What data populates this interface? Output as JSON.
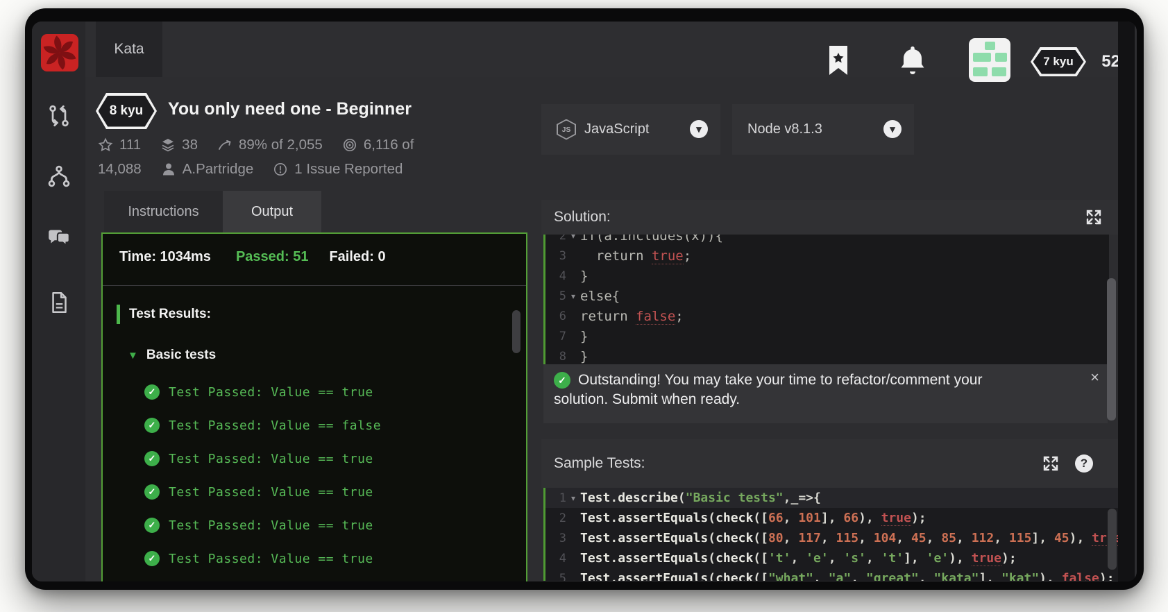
{
  "icons": {
    "chevron_down": "▾",
    "fold": "▾",
    "group_arrow": "▼",
    "check": "✓",
    "close": "×",
    "help": "?",
    "js_label": "JS"
  },
  "header": {
    "tab": "Kata",
    "rank": "7 kyu",
    "honor": "52"
  },
  "kata": {
    "rank": "8 kyu",
    "title": "You only need one - Beginner",
    "stats_row1": [
      {
        "icon": "star-icon",
        "text": "111"
      },
      {
        "icon": "layers-icon",
        "text": "38"
      },
      {
        "icon": "completion-icon",
        "text": "89% of 2,055"
      },
      {
        "icon": "target-icon",
        "text": "6,116 of"
      }
    ],
    "stats_row2": [
      {
        "icon": null,
        "text": "14,088"
      },
      {
        "icon": "person-icon",
        "text": "A.Partridge"
      },
      {
        "icon": "issue-icon",
        "text": "1 Issue Reported"
      }
    ]
  },
  "tabs": {
    "instructions": "Instructions",
    "output": "Output"
  },
  "output": {
    "time": "Time: 1034ms",
    "passed": "Passed: 51",
    "failed": "Failed: 0",
    "section": "Test Results:",
    "group": "Basic tests",
    "tests": [
      "Test Passed: Value == true",
      "Test Passed: Value == false",
      "Test Passed: Value == true",
      "Test Passed: Value == true",
      "Test Passed: Value == true",
      "Test Passed: Value == true"
    ]
  },
  "language": {
    "name": "JavaScript",
    "runtime": "Node v8.1.3"
  },
  "solution": {
    "title": "Solution:",
    "lines": [
      {
        "n": "2",
        "fold": true,
        "tokens": [
          [
            "plain",
            "if(a.includes(x)){"
          ]
        ]
      },
      {
        "n": "3",
        "tokens": [
          [
            "plain",
            "  return "
          ],
          [
            "bool",
            "true"
          ],
          [
            "plain",
            ";"
          ]
        ]
      },
      {
        "n": "4",
        "tokens": [
          [
            "plain",
            "}"
          ]
        ]
      },
      {
        "n": "5",
        "fold": true,
        "tokens": [
          [
            "plain",
            "else{"
          ]
        ]
      },
      {
        "n": "6",
        "tokens": [
          [
            "plain",
            "return "
          ],
          [
            "bool",
            "false"
          ],
          [
            "plain",
            ";"
          ]
        ]
      },
      {
        "n": "7",
        "tokens": [
          [
            "plain",
            "}"
          ]
        ]
      },
      {
        "n": "8",
        "tokens": [
          [
            "plain",
            "}"
          ]
        ]
      }
    ]
  },
  "message": {
    "line1": "Outstanding! You may take your time to refactor/comment your",
    "line2": "solution. Submit when ready."
  },
  "sample": {
    "title": "Sample Tests:",
    "lines": [
      {
        "n": "1",
        "fold": true,
        "highlight": true,
        "tokens": [
          [
            "ident",
            "Test"
          ],
          [
            "plain",
            "."
          ],
          [
            "ident",
            "describe"
          ],
          [
            "plain",
            "("
          ],
          [
            "str",
            "\"Basic tests\""
          ],
          [
            "plain",
            ",_=>{"
          ]
        ]
      },
      {
        "n": "2",
        "tokens": [
          [
            "ident",
            "Test"
          ],
          [
            "plain",
            "."
          ],
          [
            "ident",
            "assertEquals"
          ],
          [
            "plain",
            "("
          ],
          [
            "ident",
            "check"
          ],
          [
            "plain",
            "(["
          ],
          [
            "num",
            "66"
          ],
          [
            "plain",
            ", "
          ],
          [
            "num",
            "101"
          ],
          [
            "plain",
            "], "
          ],
          [
            "num",
            "66"
          ],
          [
            "plain",
            "), "
          ],
          [
            "bool",
            "true"
          ],
          [
            "plain",
            ");"
          ]
        ]
      },
      {
        "n": "3",
        "tokens": [
          [
            "ident",
            "Test"
          ],
          [
            "plain",
            "."
          ],
          [
            "ident",
            "assertEquals"
          ],
          [
            "plain",
            "("
          ],
          [
            "ident",
            "check"
          ],
          [
            "plain",
            "(["
          ],
          [
            "num",
            "80"
          ],
          [
            "plain",
            ", "
          ],
          [
            "num",
            "117"
          ],
          [
            "plain",
            ", "
          ],
          [
            "num",
            "115"
          ],
          [
            "plain",
            ", "
          ],
          [
            "num",
            "104"
          ],
          [
            "plain",
            ", "
          ],
          [
            "num",
            "45"
          ],
          [
            "plain",
            ", "
          ],
          [
            "num",
            "85"
          ],
          [
            "plain",
            ", "
          ],
          [
            "num",
            "112"
          ],
          [
            "plain",
            ", "
          ],
          [
            "num",
            "115"
          ],
          [
            "plain",
            "], "
          ],
          [
            "num",
            "45"
          ],
          [
            "plain",
            "), "
          ],
          [
            "bool",
            "true"
          ],
          [
            "plain",
            ");"
          ]
        ]
      },
      {
        "n": "4",
        "tokens": [
          [
            "ident",
            "Test"
          ],
          [
            "plain",
            "."
          ],
          [
            "ident",
            "assertEquals"
          ],
          [
            "plain",
            "("
          ],
          [
            "ident",
            "check"
          ],
          [
            "plain",
            "(["
          ],
          [
            "str",
            "'t'"
          ],
          [
            "plain",
            ", "
          ],
          [
            "str",
            "'e'"
          ],
          [
            "plain",
            ", "
          ],
          [
            "str",
            "'s'"
          ],
          [
            "plain",
            ", "
          ],
          [
            "str",
            "'t'"
          ],
          [
            "plain",
            "], "
          ],
          [
            "str",
            "'e'"
          ],
          [
            "plain",
            "), "
          ],
          [
            "bool",
            "true"
          ],
          [
            "plain",
            ");"
          ]
        ]
      },
      {
        "n": "5",
        "tokens": [
          [
            "ident",
            "Test"
          ],
          [
            "plain",
            "."
          ],
          [
            "ident",
            "assertEquals"
          ],
          [
            "plain",
            "("
          ],
          [
            "ident",
            "check"
          ],
          [
            "plain",
            "(["
          ],
          [
            "str",
            "\"what\""
          ],
          [
            "plain",
            ", "
          ],
          [
            "str",
            "\"a\""
          ],
          [
            "plain",
            ", "
          ],
          [
            "str",
            "\"great\""
          ],
          [
            "plain",
            ", "
          ],
          [
            "str",
            "\"kata\""
          ],
          [
            "plain",
            "], "
          ],
          [
            "str",
            "\"kat\""
          ],
          [
            "plain",
            "), "
          ],
          [
            "bool",
            "false"
          ],
          [
            "plain",
            ");"
          ]
        ]
      }
    ]
  }
}
